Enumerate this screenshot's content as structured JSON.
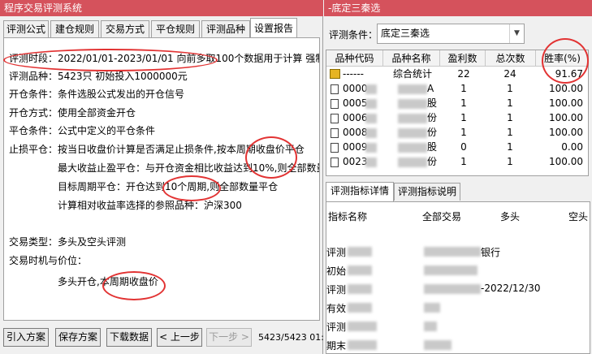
{
  "left_window": {
    "title": "程序交易评测系统",
    "tabs": [
      {
        "label": "评测公式"
      },
      {
        "label": "建仓规则"
      },
      {
        "label": "交易方式"
      },
      {
        "label": "平仓规则"
      },
      {
        "label": "评测品种"
      },
      {
        "label": "设置报告"
      }
    ],
    "report": {
      "period": "评测时段：2022/01/01-2023/01/01 向前多取100个数据用于计算 强制平",
      "varieties": "评测品种：5423只 初始投入1000000元",
      "open_cond": "开仓条件：条件选股公式发出的开仓信号",
      "open_mode": "开仓方式：使用全部资金开仓",
      "close_cond": "平仓条件：公式中定义的平仓条件",
      "stop_loss": "止损平仓：按当日收盘价计算是否满足止损条件,按本周期收盘价平仓",
      "max_profit": "最大收益止盈平仓：与开仓资金相比收益达到10%,则全部数量",
      "target_period": "目标周期平仓：开仓达到10个周期,则全部数量平仓",
      "benchmark": "计算相对收益率选择的参照品种：沪深300",
      "trade_type": "交易类型：多头及空头评测",
      "timing": "交易时机与价位：",
      "long_open": "多头开仓,本周期收盘价"
    },
    "buttons": {
      "import": "引入方案",
      "save": "保存方案",
      "download": "下载数据",
      "prev": "< 上一步",
      "next": "下一步 >"
    },
    "status": "5423/5423 01:"
  },
  "right_window": {
    "title": "-底定三秦选",
    "condition_label": "评测条件：",
    "condition_value": "底定三秦选",
    "grid": {
      "headers": [
        "品种代码",
        "品种名称",
        "盈利数",
        "总次数",
        "胜率(%)"
      ],
      "rows": [
        {
          "code": "------",
          "name": "综合统计",
          "profit": "22",
          "total": "24",
          "rate": "91.67"
        },
        {
          "code": "0000",
          "name": "A",
          "profit": "1",
          "total": "1",
          "rate": "100.00"
        },
        {
          "code": "0005",
          "name": "股",
          "profit": "1",
          "total": "1",
          "rate": "100.00"
        },
        {
          "code": "0006",
          "name": "份",
          "profit": "1",
          "total": "1",
          "rate": "100.00"
        },
        {
          "code": "0008",
          "name": "份",
          "profit": "1",
          "total": "1",
          "rate": "100.00"
        },
        {
          "code": "0009",
          "name": "股",
          "profit": "0",
          "total": "1",
          "rate": "0.00"
        },
        {
          "code": "0023",
          "name": "份",
          "profit": "1",
          "total": "1",
          "rate": "100.00"
        }
      ]
    },
    "detail_tabs": [
      {
        "label": "评测指标详情"
      },
      {
        "label": "评测指标说明"
      }
    ],
    "detail": {
      "headers": [
        "指标名称",
        "全部交易",
        "多头",
        "空头"
      ],
      "rows": [
        {
          "name": "评测",
          "value": "银行"
        },
        {
          "name": "初始",
          "value": ""
        },
        {
          "name": "评测",
          "value": "-2022/12/30"
        },
        {
          "name": "有效",
          "value": ""
        },
        {
          "name": "评测",
          "value": ""
        },
        {
          "name": "期末",
          "value": ""
        }
      ]
    }
  }
}
